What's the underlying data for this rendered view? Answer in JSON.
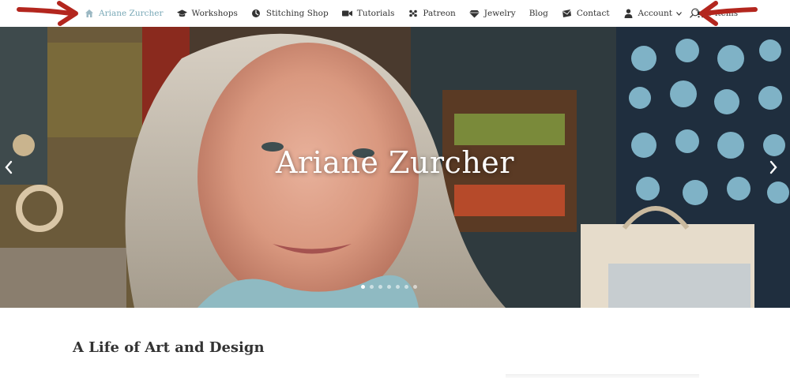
{
  "nav": {
    "items": [
      {
        "label": "Ariane Zurcher",
        "icon": "home-icon",
        "active": true
      },
      {
        "label": "Workshops",
        "icon": "graduation-cap-icon"
      },
      {
        "label": "Stitching Shop",
        "icon": "shop-icon"
      },
      {
        "label": "Tutorials",
        "icon": "video-camera-icon"
      },
      {
        "label": "Patreon",
        "icon": "community-icon"
      },
      {
        "label": "Jewelry",
        "icon": "diamond-icon"
      },
      {
        "label": "Blog",
        "icon": ""
      },
      {
        "label": "Contact",
        "icon": "envelope-icon"
      },
      {
        "label": "Account",
        "icon": "user-icon",
        "dropdown": true
      },
      {
        "label": "0 items",
        "icon": "cart-icon"
      }
    ],
    "search_icon": "search-icon",
    "active_color": "#7aa9b7"
  },
  "hero": {
    "title": "Ariane Zurcher",
    "slide_count": 7,
    "active_slide": 1
  },
  "main": {
    "section_title": "A Life of Art and Design"
  },
  "annotations": {
    "arrow_color": "#b3261e"
  }
}
